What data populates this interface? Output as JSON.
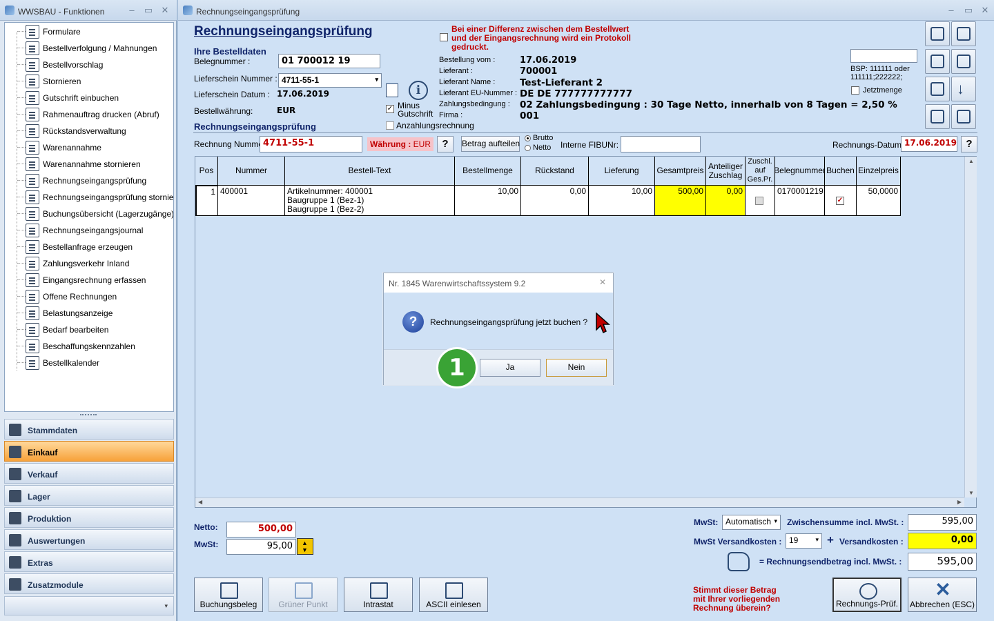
{
  "left_window": {
    "title": "WWSBAU - Funktionen"
  },
  "tree": [
    {
      "label": "Formulare",
      "icon": "form-icon"
    },
    {
      "label": "Bestellverfolgung / Mahnungen",
      "icon": "map-icon"
    },
    {
      "label": "Bestellvorschlag",
      "icon": "cart-icon"
    },
    {
      "label": "Stornieren",
      "icon": "cart-cancel-icon"
    },
    {
      "label": "Gutschrift einbuchen",
      "icon": "credit-icon"
    },
    {
      "label": "Rahmenauftrag drucken (Abruf)",
      "icon": "print-icon"
    },
    {
      "label": "Rückstandsverwaltung",
      "icon": "clock-icon"
    },
    {
      "label": "Warenannahme",
      "icon": "goods-receipt-icon"
    },
    {
      "label": "Warenannahme stornieren",
      "icon": "goods-receipt-cancel-icon"
    },
    {
      "label": "Rechnungseingangsprüfung",
      "icon": "euro-doc-icon"
    },
    {
      "label": "Rechnungseingangsprüfung stornieren",
      "icon": "euro-cancel-icon"
    },
    {
      "label": "Buchungsübersicht (Lagerzugänge)",
      "icon": "booking-icon"
    },
    {
      "label": "Rechnungseingangsjournal",
      "icon": "journal-icon"
    },
    {
      "label": "Bestellanfrage erzeugen",
      "icon": "request-icon"
    },
    {
      "label": "Zahlungsverkehr Inland",
      "icon": "payment-icon"
    },
    {
      "label": "Eingangsrechnung erfassen",
      "icon": "invoice-icon"
    },
    {
      "label": "Offene Rechnungen",
      "icon": "open-invoice-icon"
    },
    {
      "label": "Belastungsanzeige",
      "icon": "weight-icon"
    },
    {
      "label": "Bedarf bearbeiten",
      "icon": "basket-icon"
    },
    {
      "label": "Beschaffungskennzahlen",
      "icon": "stats-icon"
    },
    {
      "label": "Bestellkalender",
      "icon": "calendar-icon"
    }
  ],
  "nav": [
    {
      "label": "Stammdaten",
      "active": false
    },
    {
      "label": "Einkauf",
      "active": true
    },
    {
      "label": "Verkauf",
      "active": false
    },
    {
      "label": "Lager",
      "active": false
    },
    {
      "label": "Produktion",
      "active": false
    },
    {
      "label": "Auswertungen",
      "active": false
    },
    {
      "label": "Extras",
      "active": false
    },
    {
      "label": "Zusatzmodule",
      "active": false
    }
  ],
  "main": {
    "window_title": "Rechnungseingangsprüfung",
    "heading": "Rechnungseingangsprüfung",
    "section_order": "Ihre Bestelldaten",
    "section_invoice": "Rechnungseingangsprüfung",
    "belegnummer_label": "Belegnummer :",
    "belegnummer": "01 700012 19",
    "lieferschein_nr_label": "Lieferschein Nummer :",
    "lieferschein_nr": "4711-55-1",
    "lieferschein_datum_label": "Lieferschein Datum :",
    "lieferschein_datum": "17.06.2019",
    "waehrung_label": "Bestellwährung:",
    "waehrung": "EUR",
    "minus_gutschrift": "Minus Gutschrift",
    "anzahlung": "Anzahlungsrechnung",
    "warning": "Bei einer Differenz zwischen dem Bestellwert und der Eingangsrechnung wird ein Protokoll gedruckt.",
    "info": [
      {
        "label": "Bestellung vom :",
        "value": "17.06.2019"
      },
      {
        "label": "Lieferant :",
        "value": "700001"
      },
      {
        "label": "Lieferant Name :",
        "value": "Test-Lieferant 2"
      },
      {
        "label": "Lieferant EU-Nummer :",
        "value": "DE   DE 777777777777"
      },
      {
        "label": "Zahlungsbedingung :",
        "value": "02    Zahlungsbedingung : 30 Tage Netto, innerhalb von 8 Tagen = 2,50 %"
      },
      {
        "label": "Firma :",
        "value": "001"
      }
    ],
    "bsp_hint": "BSP: 111111 oder 111111;222222;",
    "jetztmenge": "Jetztmenge",
    "rechnung_nr_label": "Rechnung Nummer",
    "rechnung_nr": "4711-55-1",
    "waehrung2_label": "Währung :",
    "waehrung2": "EUR",
    "help": "?",
    "betrag_aufteilen": "Betrag aufteilen",
    "brutto": "Brutto",
    "netto": "Netto",
    "fibu_label": "Interne FIBUNr:",
    "rechnungsdatum_label": "Rechnungs-Datum :",
    "rechnungsdatum": "17.06.2019"
  },
  "grid": {
    "headers": [
      "Pos",
      "Nummer",
      "Bestell-Text",
      "Bestellmenge",
      "Rückstand",
      "Lieferung",
      "Gesamtpreis",
      "Anteiliger Zuschlag",
      "Zuschl. auf Ges.Pr.",
      "Belegnummer",
      "Buchen",
      "Einzelpreis"
    ],
    "row": {
      "pos": "1",
      "nummer": "400001",
      "text1": "Artikelnummer: 400001",
      "text2": "Baugruppe 1  (Bez-1)",
      "text3": "Baugruppe 1  (Bez-2)",
      "bestellmenge": "10,00",
      "rueckstand": "0,00",
      "lieferung": "10,00",
      "gesamtpreis": "500,00",
      "zuschlag": "0,00",
      "belegnummer": "0170001219",
      "einzelpreis": "50,0000"
    }
  },
  "totals": {
    "netto_label": "Netto:",
    "netto": "500,00",
    "mwst_label": "MwSt:",
    "mwst": "95,00",
    "mwst_mode_label": "MwSt:",
    "mwst_mode": "Automatisch",
    "zwischensumme_label": "Zwischensumme incl. MwSt. :",
    "zwischensumme": "595,00",
    "mwst_versand_label": "MwSt Versandkosten :",
    "mwst_versand": "19",
    "versand_label": "Versandkosten :",
    "versand": "0,00",
    "endbetrag_label": "= Rechnungsendbetrag incl. MwSt. :",
    "endbetrag": "595,00",
    "question": "Stimmt dieser Betrag mit Ihrer vorliegenden Rechnung überein?"
  },
  "buttons": {
    "buchungsbeleg": "Buchungsbeleg",
    "gruener_punkt": "Grüner Punkt",
    "intrastat": "Intrastat",
    "ascii": "ASCII einlesen",
    "rechnungs_pruef": "Rechnungs-Prüf.",
    "abbrechen": "Abbrechen (ESC)"
  },
  "dialog": {
    "title": "Nr. 1845 Warenwirtschaftssystem 9.2",
    "message": "Rechnungseingangsprüfung jetzt buchen ?",
    "yes": "Ja",
    "no": "Nein",
    "step": "1"
  },
  "colors": {
    "highlight": "#ffff00",
    "red": "#c00000",
    "navy": "#10246a",
    "step_green": "#3aa335"
  }
}
